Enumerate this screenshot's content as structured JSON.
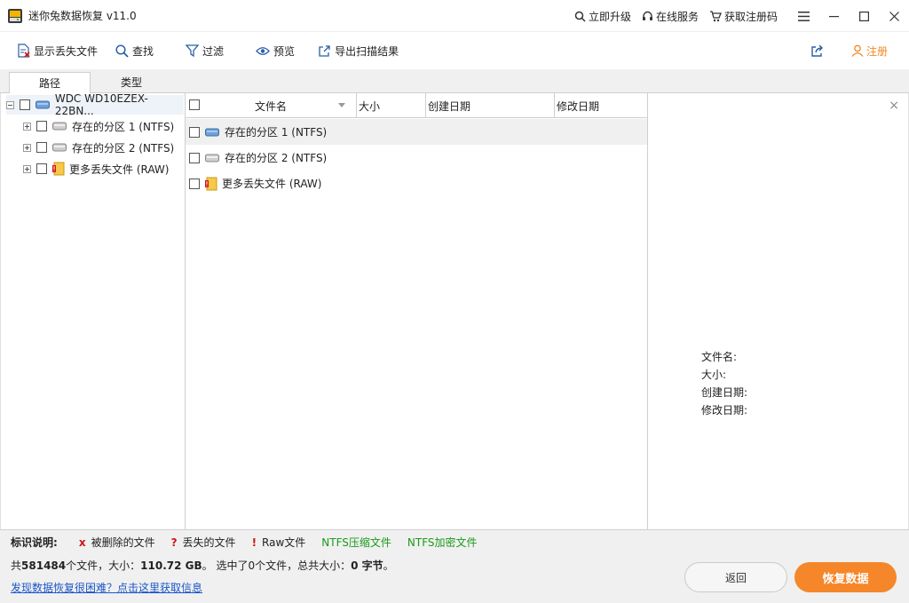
{
  "window": {
    "title": "迷你兔数据恢复 v11.0",
    "links": {
      "upgrade": "立即升级",
      "online_service": "在线服务",
      "get_code": "获取注册码"
    }
  },
  "toolbar": {
    "show_lost": "显示丢失文件",
    "find": "查找",
    "filter": "过滤",
    "preview": "预览",
    "export": "导出扫描结果",
    "register": "注册"
  },
  "tabs": [
    {
      "label": "路径"
    },
    {
      "label": "类型"
    }
  ],
  "tree": {
    "root": "WDC WD10EZEX-22BN...",
    "items": [
      {
        "label": "存在的分区 1 (NTFS)"
      },
      {
        "label": "存在的分区 2 (NTFS)"
      },
      {
        "label": "更多丢失文件 (RAW)"
      }
    ]
  },
  "columns": {
    "name": "文件名",
    "size": "大小",
    "created": "创建日期",
    "modified": "修改日期"
  },
  "files": [
    {
      "name": "存在的分区 1 (NTFS)"
    },
    {
      "name": "存在的分区 2 (NTFS)"
    },
    {
      "name": "更多丢失文件 (RAW)"
    }
  ],
  "properties": {
    "name": "文件名:",
    "size": "大小:",
    "created": "创建日期:",
    "modified": "修改日期:"
  },
  "legend": {
    "title": "标识说明:",
    "deleted": "被删除的文件",
    "lost": "丢失的文件",
    "raw": "Raw文件",
    "ntfs_compressed": "NTFS压缩文件",
    "ntfs_encrypted": "NTFS加密文件",
    "deleted_mark": "x",
    "lost_mark": "?",
    "raw_mark": "!"
  },
  "summary": {
    "prefix": "共",
    "file_count": "581484",
    "files_suffix": "个文件，大小：",
    "total_size": "110.72 GB",
    "selected_prefix": "。 选中了",
    "selected_count": "0",
    "selected_mid": "个文件，总共大小：",
    "selected_size": "0 字节",
    "suffix": "。"
  },
  "help_link": "发现数据恢复很困难？点击这里获取信息",
  "buttons": {
    "back": "返回",
    "recover": "恢复数据"
  },
  "colors": {
    "accent": "#f5862a",
    "link": "#1a56c8",
    "ntfs_green": "#1a9a1a",
    "mark_red": "#d01414"
  }
}
